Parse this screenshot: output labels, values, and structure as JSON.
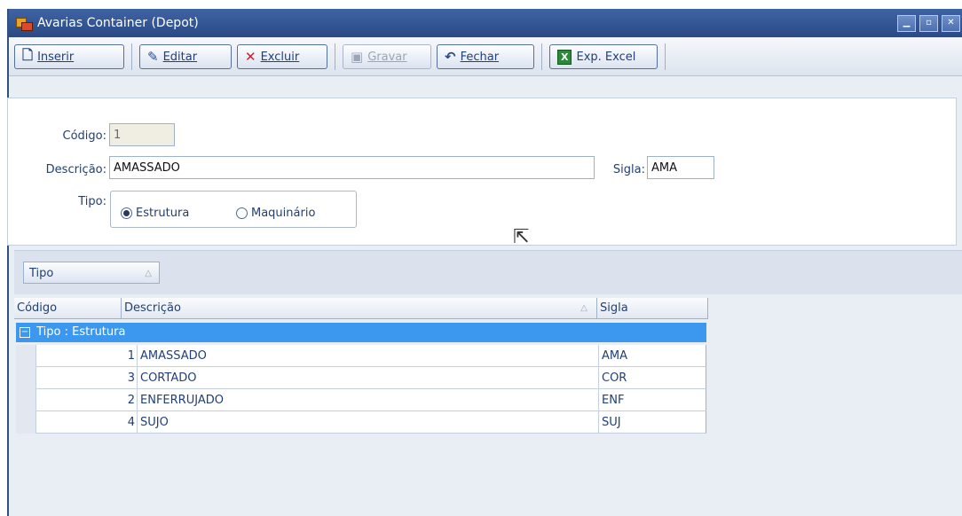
{
  "window": {
    "title": "Avarias Container (Depot)"
  },
  "toolbar": {
    "inserir": "Inserir",
    "editar": "Editar",
    "excluir": "Excluir",
    "gravar": "Gravar",
    "fechar": "Fechar",
    "exp_excel": "Exp. Excel"
  },
  "form": {
    "codigo_label": "Código:",
    "codigo_value": "1",
    "descricao_label": "Descrição:",
    "descricao_value": "AMASSADO",
    "sigla_label": "Sigla:",
    "sigla_value": "AMA",
    "tipo_label": "Tipo:",
    "tipo_options": [
      "Estrutura",
      "Maquinário"
    ],
    "tipo_selected": "Estrutura"
  },
  "grid": {
    "group_by_chip": "Tipo",
    "columns": [
      "Código",
      "Descrição",
      "Sigla"
    ],
    "group_label": "Tipo : Estrutura",
    "rows": [
      {
        "codigo": "1",
        "descricao": "AMASSADO",
        "sigla": "AMA"
      },
      {
        "codigo": "3",
        "descricao": "CORTADO",
        "sigla": "COR"
      },
      {
        "codigo": "2",
        "descricao": "ENFERRUJADO",
        "sigla": "ENF"
      },
      {
        "codigo": "4",
        "descricao": "SUJO",
        "sigla": "SUJ"
      }
    ]
  },
  "colors": {
    "titlebar": "#2f5394",
    "selected_group_row": "#3b98ee",
    "panel_bg": "#e9edf4"
  }
}
